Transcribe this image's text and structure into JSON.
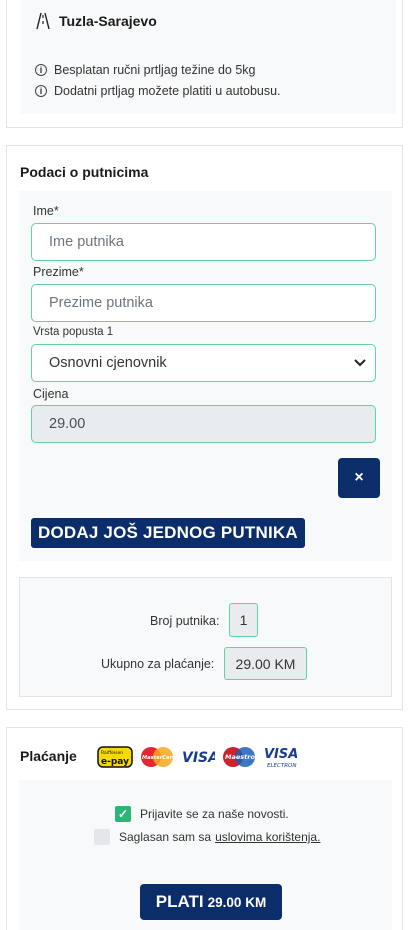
{
  "route": {
    "title": "Tuzla-Sarajevo",
    "info": [
      "Besplatan ručni prtljag težine do 5kg",
      "Dodatni prtljag možete platiti u autobusu."
    ]
  },
  "passengers": {
    "section_title": "Podaci o putnicima",
    "first_name_label": "Ime*",
    "first_name_placeholder": "Ime putnika",
    "last_name_label": "Prezime*",
    "last_name_placeholder": "Prezime putnika",
    "discount_label": "Vrsta popusta 1",
    "discount_selected": "Osnovni cjenovnik",
    "price_label": "Cijena",
    "price_value": "29.00",
    "remove_icon": "×",
    "add_button": "DODAJ JOŠ JEDNOG PUTNIKA"
  },
  "summary": {
    "count_label": "Broj putnika:",
    "count_value": "1",
    "total_label": "Ukupno za plaćanje:",
    "total_value": "29.00 KM"
  },
  "payment": {
    "section_title": "Plaćanje",
    "logos": [
      "e-pay",
      "MasterCard",
      "VISA",
      "Maestro",
      "VISA ELECTRON"
    ],
    "newsletter_label": "Prijavite se za naše novosti.",
    "newsletter_checked": true,
    "terms_prefix": "Saglasan sam sa",
    "terms_link": "uslovima korištenja.",
    "terms_checked": false,
    "pay_button_big": "PLATI",
    "pay_button_amount": "29.00 KM"
  },
  "colors": {
    "primary": "#0b2d6a",
    "field_border": "#5fd3a0",
    "checkbox_on": "#2bb673"
  }
}
